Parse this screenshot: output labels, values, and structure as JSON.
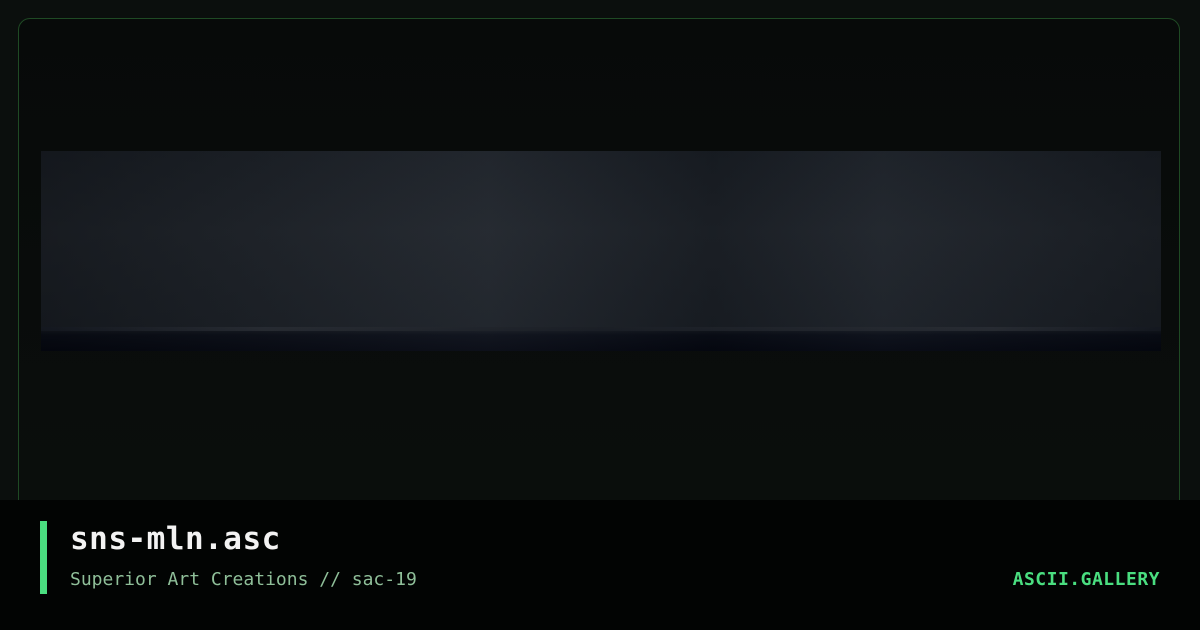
{
  "artwork": {
    "filename": "sns-mln.asc",
    "group": "Superior Art Creations",
    "separator": "//",
    "pack": "sac-19",
    "subtitle": "Superior Art Creations // sac-19"
  },
  "site": {
    "brand": "ASCII.GALLERY"
  },
  "colors": {
    "accent": "#4ade80",
    "border": "#1f4a24",
    "background": "#0b0f0d",
    "footer": "#020403",
    "title": "#f3f3f3",
    "subtitle": "#8fbf99"
  }
}
